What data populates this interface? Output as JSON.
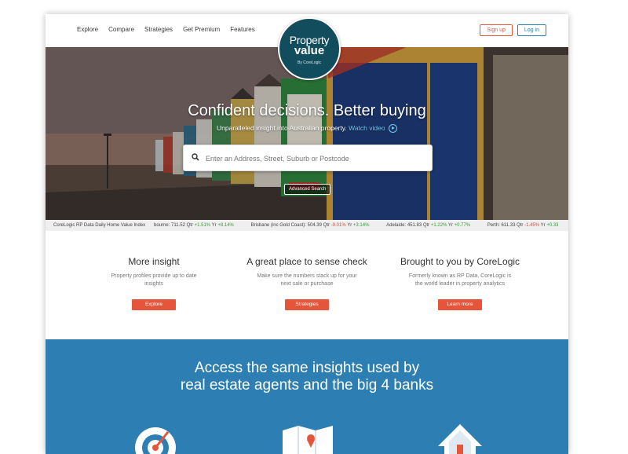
{
  "nav": {
    "links": [
      "Explore",
      "Compare",
      "Strategies",
      "Get Premium",
      "Features"
    ],
    "signup": "Sign up",
    "login": "Log in"
  },
  "logo": {
    "line1": "Property",
    "line2": "value",
    "line3": "By CoreLogic"
  },
  "hero": {
    "title": "Confident decisions. Better buying",
    "subtitle": "Unparalleled insight into Australian property.",
    "watch_video": "Watch video",
    "search_placeholder": "Enter an Address, Street, Suburb or Postcode",
    "advanced_search": "Advanced Search"
  },
  "ticker": {
    "label": "CoreLogic RP Data Daily Home Value Index",
    "items": [
      {
        "city": "bourne:",
        "value": "711.52",
        "qtr": "+1.51%",
        "yr": "+8.14%"
      },
      {
        "city": "Brisbane (inc Gold Coast):",
        "value": "504.39",
        "qtr": "-0.01%",
        "yr": "+3.14%"
      },
      {
        "city": "Adelaide:",
        "value": "451.83",
        "qtr": "+1.22%",
        "yr": "+0.77%"
      },
      {
        "city": "Perth:",
        "value": "611.33",
        "qtr": "-1.45%",
        "yr": "+0.33"
      }
    ]
  },
  "features": [
    {
      "title": "More insight",
      "text_line1": "Property profiles provide up to date",
      "text_line2": "insights",
      "button": "Explore"
    },
    {
      "title": "A great place to sense check",
      "text_line1": "Make sure the numbers stack up for your",
      "text_line2": "next sale or purchase",
      "button": "Strategies"
    },
    {
      "title": "Brought to you by CoreLogic",
      "text_line1": "Formerly known as RP Data, CoreLogic is",
      "text_line2": "the world leader in property analytics",
      "button": "Learn more"
    }
  ],
  "banner": {
    "line1": "Access the same insights used by",
    "line2": "real estate agents and the big 4 banks"
  },
  "colors": {
    "accent_orange": "#e4553a",
    "accent_blue": "#2d7fb3",
    "logo_teal": "#124d5e"
  },
  "icons": [
    "search-icon",
    "play-icon",
    "target-gauge-icon",
    "map-icon",
    "house-icon"
  ]
}
